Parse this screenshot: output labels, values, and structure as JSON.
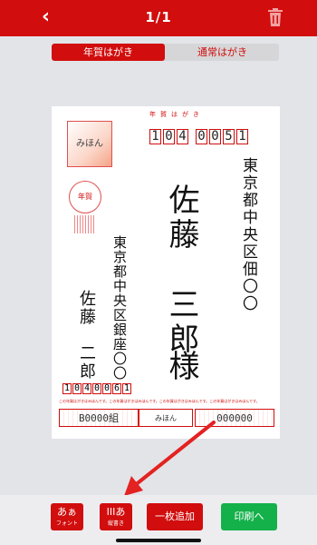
{
  "header": {
    "back_glyph": "‹",
    "page_indicator": "1/1"
  },
  "tabs": [
    {
      "label": "年賀はがき",
      "active": true
    },
    {
      "label": "通常はがき",
      "active": false
    }
  ],
  "postcard": {
    "stamp_text": "みほん",
    "nenga_text": "年賀",
    "hagaki_label": "年賀はがき",
    "recipient": {
      "zip": [
        "1",
        "0",
        "4",
        "0",
        "0",
        "5",
        "1"
      ],
      "address": "東京都中央区佃〇〇",
      "name_family": "佐藤",
      "name_given": "三郎",
      "honorific": "様"
    },
    "sender": {
      "address": "東京都中央区銀座〇〇",
      "name_family": "佐藤",
      "name_given": "二郎",
      "zip": [
        "1",
        "0",
        "4",
        "0",
        "0",
        "6",
        "1"
      ]
    },
    "fine_print": "この年賀はがきはみほんです。この年賀はがきはみほんです。この年賀はがきはみほんです。この年賀はがきはみほんです。",
    "lottery": {
      "left": "B0000組",
      "middle": "みほん",
      "right": "000000"
    }
  },
  "toolbar": {
    "font_big": "あぁ",
    "font_small": "フォント",
    "vertical_big": "IIIあ",
    "vertical_small": "縦書き",
    "add_label": "一枚追加",
    "print_label": "印刷へ"
  },
  "colors": {
    "brand_red": "#d10d0d",
    "print_green": "#14b14a",
    "annotation_arrow": "#e32222"
  }
}
